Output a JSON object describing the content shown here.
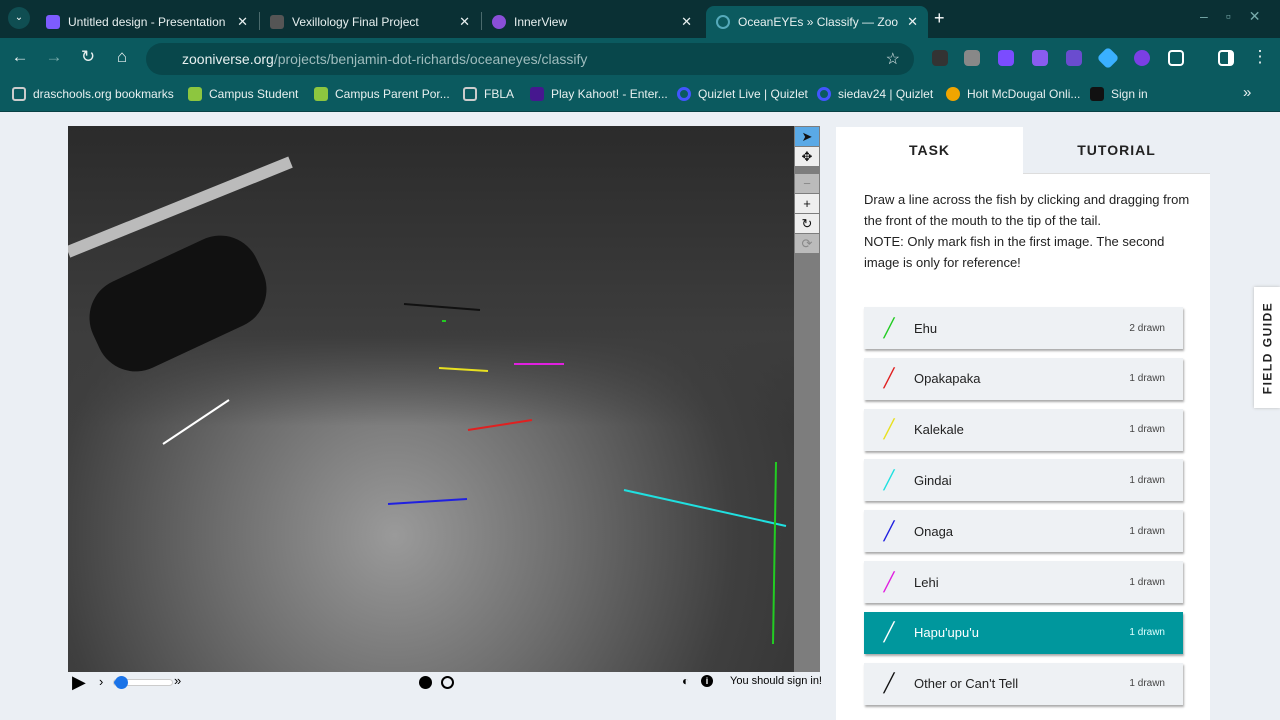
{
  "browser": {
    "tabs": [
      {
        "title": "Untitled design - Presentation",
        "color": "#7d5cff"
      },
      {
        "title": "Vexillology Final Project",
        "color": "#555555"
      },
      {
        "title": "InnerView",
        "color": "#8a4fd8"
      },
      {
        "title": "OceanEYEs » Classify — Zooni",
        "color": "#0b5a5f"
      }
    ],
    "url_host": "zooniverse.org",
    "url_path": "/projects/benjamin-dot-richards/oceaneyes/classify",
    "bookmarks": [
      {
        "label": "draschools.org bookmarks",
        "color": "#cccccc"
      },
      {
        "label": "Campus Student",
        "color": "#8dc63f"
      },
      {
        "label": "Campus Parent Por...",
        "color": "#8dc63f"
      },
      {
        "label": "FBLA",
        "color": "#cccccc"
      },
      {
        "label": "Play Kahoot! - Enter...",
        "color": "#46178f"
      },
      {
        "label": "Quizlet Live | Quizlet",
        "color": "#4255ff"
      },
      {
        "label": "siedav24 | Quizlet",
        "color": "#4255ff"
      },
      {
        "label": "Holt McDougal Onli...",
        "color": "#f0a500"
      },
      {
        "label": "Sign in",
        "color": "#111111"
      }
    ]
  },
  "viewer": {
    "sign_in_notice": "You should sign in!",
    "playback_speed": 0.15
  },
  "panel": {
    "tabs": {
      "task": "TASK",
      "tutorial": "TUTORIAL"
    },
    "instruction": "Draw a line across the fish by clicking and dragging from the front of the mouth to the tip of the tail.",
    "note": "NOTE: Only mark fish in the first image. The second image is only for reference!",
    "options": [
      {
        "label": "Ehu",
        "count": "2 drawn",
        "color": "#22cc22"
      },
      {
        "label": "Opakapaka",
        "count": "1 drawn",
        "color": "#e02020"
      },
      {
        "label": "Kalekale",
        "count": "1 drawn",
        "color": "#e8e020"
      },
      {
        "label": "Gindai",
        "count": "1 drawn",
        "color": "#20e0e0"
      },
      {
        "label": "Onaga",
        "count": "1 drawn",
        "color": "#2020e0"
      },
      {
        "label": "Lehi",
        "count": "1 drawn",
        "color": "#e020e0"
      },
      {
        "label": "Hapu'upu'u",
        "count": "1 drawn",
        "color": "#ffffff"
      },
      {
        "label": "Other or Can't Tell",
        "count": "1 drawn",
        "color": "#111111"
      }
    ],
    "selected": "Hapu'upu'u",
    "field_guide": "FIELD GUIDE"
  }
}
